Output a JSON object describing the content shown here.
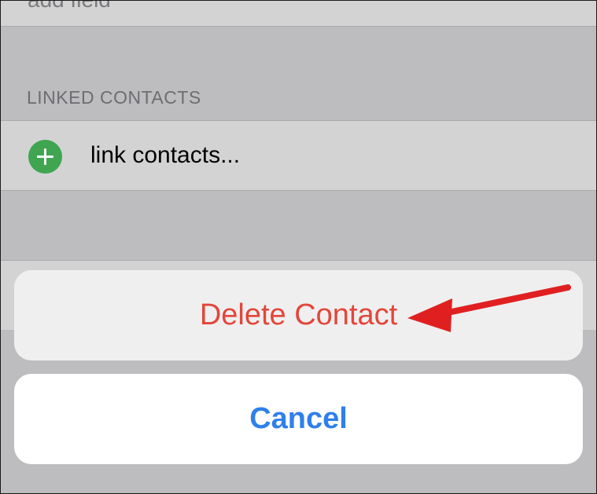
{
  "top_row": {
    "text": "add field"
  },
  "section": {
    "header": "LINKED CONTACTS"
  },
  "link_row": {
    "label": "link contacts...",
    "icon": "add-circle-icon",
    "icon_color": "#3fa550"
  },
  "action_sheet": {
    "delete_label": "Delete Contact",
    "delete_color": "#e3463b",
    "cancel_label": "Cancel",
    "cancel_color": "#2f7fec"
  },
  "annotation": {
    "type": "arrow",
    "color": "#e02020",
    "points_to": "Delete Contact"
  }
}
